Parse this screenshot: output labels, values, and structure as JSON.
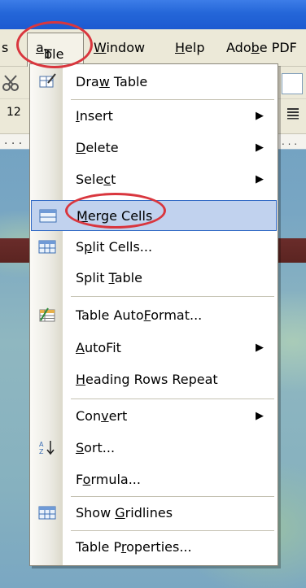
{
  "menubar": {
    "items": [
      {
        "label": "s"
      },
      {
        "pre": "T",
        "mn": "a",
        "post": "ble"
      },
      {
        "pre": "",
        "mn": "W",
        "post": "indow"
      },
      {
        "pre": "",
        "mn": "H",
        "post": "elp"
      },
      {
        "pre": "Ado",
        "mn": "b",
        "post": "e PDF"
      }
    ]
  },
  "toolbar": {
    "font_size_fragment": "12",
    "ruler_dots": ". . ."
  },
  "menu": {
    "items": [
      {
        "pre": "Dra",
        "mn": "w",
        "post": " Table",
        "icon": "draw-table-icon",
        "submenu": false
      },
      {
        "pre": "",
        "mn": "I",
        "post": "nsert",
        "icon": "",
        "submenu": true
      },
      {
        "pre": "",
        "mn": "D",
        "post": "elete",
        "icon": "",
        "submenu": true
      },
      {
        "pre": "Sele",
        "mn": "c",
        "post": "t",
        "icon": "",
        "submenu": true
      },
      {
        "pre": "",
        "mn": "M",
        "post": "erge Cells",
        "icon": "merge-cells-icon",
        "submenu": false,
        "highlighted": true
      },
      {
        "pre": "S",
        "mn": "p",
        "post": "lit Cells...",
        "icon": "split-cells-icon",
        "submenu": false
      },
      {
        "pre": "Split ",
        "mn": "T",
        "post": "able",
        "icon": "",
        "submenu": false
      },
      {
        "pre": "Table Auto",
        "mn": "F",
        "post": "ormat...",
        "icon": "table-autoformat-icon",
        "submenu": false
      },
      {
        "pre": "",
        "mn": "A",
        "post": "utoFit",
        "icon": "",
        "submenu": true
      },
      {
        "pre": "",
        "mn": "H",
        "post": "eading Rows Repeat",
        "icon": "",
        "submenu": false
      },
      {
        "pre": "Con",
        "mn": "v",
        "post": "ert",
        "icon": "",
        "submenu": true
      },
      {
        "pre": "",
        "mn": "S",
        "post": "ort...",
        "icon": "sort-az-icon",
        "submenu": false
      },
      {
        "pre": "F",
        "mn": "o",
        "post": "rmula...",
        "icon": "",
        "submenu": false
      },
      {
        "pre": "Show ",
        "mn": "G",
        "post": "ridlines",
        "icon": "show-gridlines-icon",
        "submenu": false
      },
      {
        "pre": "Table P",
        "mn": "r",
        "post": "operties...",
        "icon": "",
        "submenu": false
      }
    ]
  },
  "colors": {
    "highlight": "#c1d2ee",
    "highlight_border": "#316ac5",
    "annotation": "#d9363e"
  }
}
